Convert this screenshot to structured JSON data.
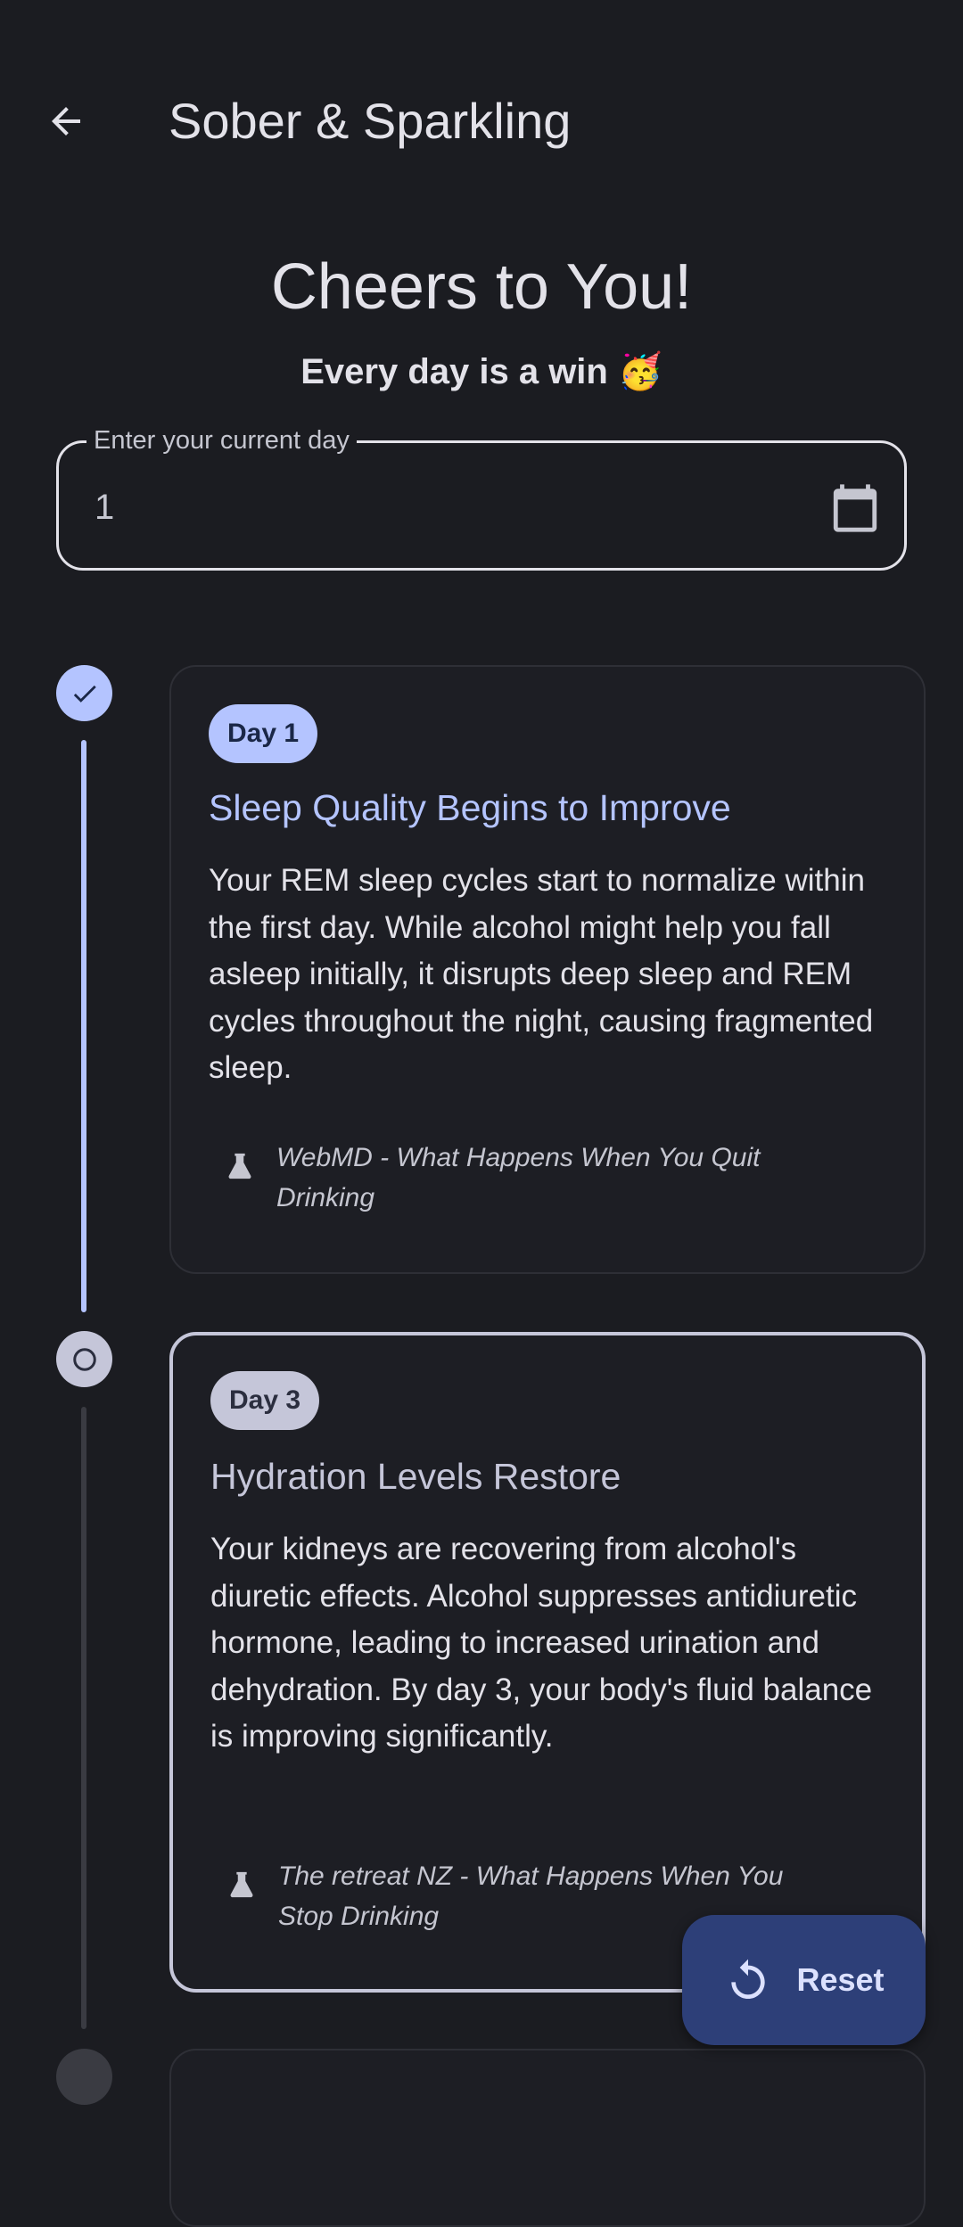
{
  "app_bar": {
    "back_icon": "arrow-left-icon",
    "title": "Sober & Sparkling"
  },
  "hero": {
    "title": "Cheers to You!",
    "subtitle": "Every day is a win 🥳"
  },
  "day_input": {
    "label": "Enter your current day",
    "value": "1",
    "trailing_icon": "calendar-icon"
  },
  "timeline": {
    "milestones": [
      {
        "state": "completed",
        "node_icon": "check-icon",
        "badge": "Day 1",
        "title": "Sleep Quality Begins to Improve",
        "body": "Your REM sleep cycles start to normalize within the first day. While alcohol might help you fall asleep initially, it disrupts deep sleep and REM cycles throughout the night, causing fragmented sleep.",
        "source_icon": "flask-icon",
        "source": "WebMD - What Happens When You Quit Drinking"
      },
      {
        "state": "current",
        "node_icon": "circle-outline-icon",
        "badge": "Day 3",
        "title": "Hydration Levels Restore",
        "body": "Your kidneys are recovering from alcohol's diuretic effects. Alcohol suppresses antidiuretic hormone, leading to increased urination and dehydration. By day 3, your body's fluid balance is improving significantly.",
        "source_icon": "flask-icon",
        "source": "The retreat NZ - What Happens When You Stop Drinking"
      }
    ]
  },
  "fab": {
    "icon": "restart-icon",
    "label": "Reset"
  },
  "colors": {
    "background": "#1b1c21",
    "primary": "#b4c4ff",
    "secondary": "#c5c6d9",
    "fab": "#2d3f78"
  }
}
